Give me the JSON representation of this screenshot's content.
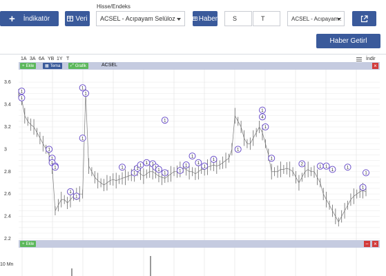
{
  "toolbar": {
    "indicator_label": "İndikatör",
    "veri_label": "Veri",
    "hisse_label": "Hisse/Endeks",
    "hisse_value": "ACSEL - Acıpayam Selüloz",
    "haber_label": "Haber",
    "date_start": "S",
    "date_end": "T",
    "news_select_value": "ACSEL - Acıpayam :",
    "haber_getir_label": "Haber Getirl"
  },
  "periods": [
    "1A",
    "3A",
    "6A",
    "YB",
    "1Y",
    "T"
  ],
  "indir_label": "İndir",
  "price_panel": {
    "ekle": "Ekle",
    "tema": "Tema",
    "grafik": "Grafik",
    "symbol": "ACSEL",
    "close": "×"
  },
  "volume_panel": {
    "ekle": "Ekle",
    "close": "×",
    "axis_label": "10 Mn"
  },
  "colors": {
    "accent": "#3a5a9b",
    "panel_header": "#c5cbe0",
    "green": "#5cb85c",
    "red": "#d23b3b",
    "marker": "#6a4fc9"
  },
  "chart_data": {
    "type": "line",
    "ylim": [
      2.2,
      3.65
    ],
    "yticks": [
      "3.6",
      "3.4",
      "3.2",
      "3",
      "2.8",
      "2.6",
      "2.4",
      "2.2"
    ],
    "series": [
      {
        "values": [
          3.5,
          3.45,
          3.3,
          3.25,
          3.22,
          3.2,
          3.15,
          3.1,
          3.05,
          3.0,
          2.95,
          2.85,
          2.45,
          2.5,
          2.55,
          2.55,
          2.52,
          2.55,
          2.58,
          2.6,
          2.6,
          2.6,
          3.5,
          2.85,
          2.8,
          2.75,
          2.72,
          2.7,
          2.68,
          2.7,
          2.72,
          2.73,
          2.72,
          2.73,
          2.74,
          2.75,
          2.76,
          2.77,
          2.78,
          2.8,
          2.78,
          2.76,
          2.78,
          2.8,
          2.8,
          2.78,
          2.76,
          2.75,
          2.74,
          2.76,
          2.78,
          2.8,
          2.8,
          2.82,
          2.83,
          2.82,
          2.8,
          2.8,
          2.78,
          2.8,
          2.82,
          2.82,
          2.84,
          2.85,
          2.86,
          2.85,
          2.86,
          2.88,
          2.9,
          2.92,
          3.0,
          3.3,
          3.25,
          3.2,
          3.1,
          3.05,
          3.05,
          3.1,
          3.15,
          3.2,
          3.15,
          3.05,
          2.95,
          2.8,
          2.8,
          2.8,
          2.82,
          2.82,
          2.83,
          2.82,
          2.8,
          2.75,
          2.7,
          2.75,
          2.8,
          2.82,
          2.8,
          2.8,
          2.75,
          2.7,
          2.6,
          2.55,
          2.5,
          2.45,
          2.4,
          2.35,
          2.4,
          2.45,
          2.5,
          2.55,
          2.58,
          2.6,
          2.62,
          2.63,
          2.62
        ]
      }
    ],
    "markers": [
      {
        "i": 1,
        "y": 3.52,
        "label": "1"
      },
      {
        "i": 1,
        "y": 3.46,
        "label": "1"
      },
      {
        "i": 10,
        "y": 3.0,
        "label": "1"
      },
      {
        "i": 11,
        "y": 2.92,
        "label": "1"
      },
      {
        "i": 11,
        "y": 2.88,
        "label": "1"
      },
      {
        "i": 12,
        "y": 2.85,
        "label": "1"
      },
      {
        "i": 12,
        "y": 2.84,
        "label": "1"
      },
      {
        "i": 17,
        "y": 2.62,
        "label": "1"
      },
      {
        "i": 19,
        "y": 2.58,
        "label": "1"
      },
      {
        "i": 21,
        "y": 3.55,
        "label": "1"
      },
      {
        "i": 22,
        "y": 3.5,
        "label": "1"
      },
      {
        "i": 21,
        "y": 3.1,
        "label": "1"
      },
      {
        "i": 34,
        "y": 2.84,
        "label": "1"
      },
      {
        "i": 38,
        "y": 2.79,
        "label": "1"
      },
      {
        "i": 39,
        "y": 2.83,
        "label": "1"
      },
      {
        "i": 40,
        "y": 2.86,
        "label": "1"
      },
      {
        "i": 42,
        "y": 2.88,
        "label": "1"
      },
      {
        "i": 44,
        "y": 2.87,
        "label": "1"
      },
      {
        "i": 45,
        "y": 2.84,
        "label": "1"
      },
      {
        "i": 46,
        "y": 2.82,
        "label": "1"
      },
      {
        "i": 48,
        "y": 2.79,
        "label": "1"
      },
      {
        "i": 48,
        "y": 3.26,
        "label": "1"
      },
      {
        "i": 53,
        "y": 2.81,
        "label": "1"
      },
      {
        "i": 55,
        "y": 2.86,
        "label": "1"
      },
      {
        "i": 57,
        "y": 2.94,
        "label": "1"
      },
      {
        "i": 59,
        "y": 2.88,
        "label": "1"
      },
      {
        "i": 61,
        "y": 2.85,
        "label": "1"
      },
      {
        "i": 64,
        "y": 2.91,
        "label": "1"
      },
      {
        "i": 72,
        "y": 3.0,
        "label": "1"
      },
      {
        "i": 80,
        "y": 3.35,
        "label": "1"
      },
      {
        "i": 80,
        "y": 3.29,
        "label": "4"
      },
      {
        "i": 81,
        "y": 3.2,
        "label": "1"
      },
      {
        "i": 83,
        "y": 2.92,
        "label": "1"
      },
      {
        "i": 93,
        "y": 2.87,
        "label": "2"
      },
      {
        "i": 99,
        "y": 2.85,
        "label": "1"
      },
      {
        "i": 101,
        "y": 2.85,
        "label": "1"
      },
      {
        "i": 103,
        "y": 2.82,
        "label": "1"
      },
      {
        "i": 108,
        "y": 2.84,
        "label": "1"
      },
      {
        "i": 113,
        "y": 2.66,
        "label": "1"
      },
      {
        "i": 114,
        "y": 2.79,
        "label": "1"
      }
    ]
  }
}
